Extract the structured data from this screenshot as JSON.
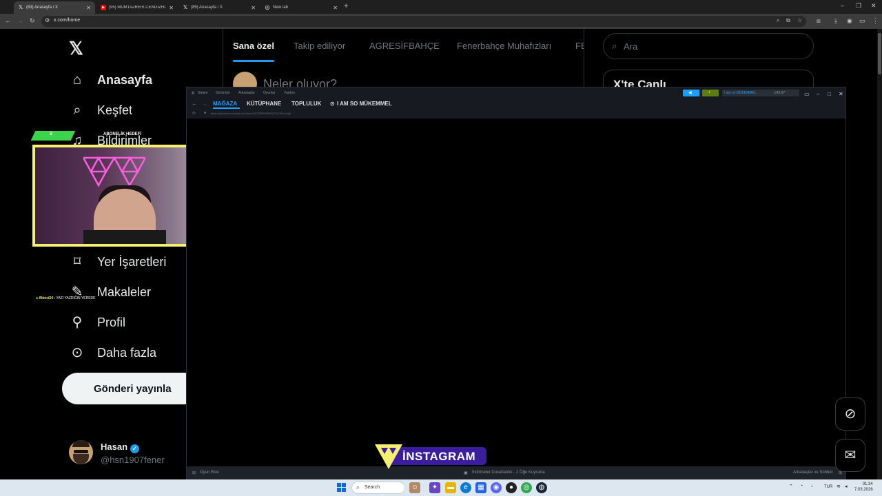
{
  "browser": {
    "tabs": [
      {
        "title": "(83) Anasayfa / X",
        "icon": "x-logo-icon",
        "active": true
      },
      {
        "title": "(95) MÜMTAZREİS CENGİZHAN",
        "icon": "youtube-icon",
        "active": false
      },
      {
        "title": "(85) Anasayfa / X",
        "icon": "x-logo-icon",
        "active": false
      },
      {
        "title": "New tab",
        "icon": "globe-icon",
        "active": false
      }
    ],
    "new_tab_symbol": "+",
    "url": "x.com/home"
  },
  "x": {
    "logo": "𝕏",
    "nav": [
      {
        "label": "Anasayfa",
        "icon": "home-icon",
        "glyph": "⌂",
        "bold": true
      },
      {
        "label": "Keşfet",
        "icon": "search-icon",
        "glyph": "⌕"
      },
      {
        "label": "Bildirimler",
        "icon": "bell-icon",
        "glyph": "♫"
      },
      {
        "label": "Yer İşaretleri",
        "icon": "bookmark-icon",
        "glyph": "⌑"
      },
      {
        "label": "Makaleler",
        "icon": "article-icon",
        "glyph": "✎"
      },
      {
        "label": "Profil",
        "icon": "profile-icon",
        "glyph": "⚲"
      },
      {
        "label": "Daha fazla",
        "icon": "more-icon",
        "glyph": "⊙"
      }
    ],
    "post_button": "Gönderi yayınla",
    "user": {
      "name": "Hasan",
      "handle": "@hsn1907fener",
      "verified_glyph": "✓"
    },
    "center_tabs": [
      "Sana özel",
      "Takip ediliyor",
      "AGRESİFBAHÇE",
      "Fenerbahçe Muhafızları",
      "FE"
    ],
    "compose_placeholder": "Neler oluyor?",
    "search_placeholder": "Ara",
    "live_title": "X'te Canlı",
    "accent": "#1d9bf0"
  },
  "overlay": {
    "goal_number": "2",
    "goal_label": "ABONELİK HEDEFİ",
    "goal_target": "10",
    "chat_user": "Akinci24 :",
    "chat_text": "YAZI YAZDIĞIN YEREDE",
    "instagram_label": "İNSTAGRAM"
  },
  "steam": {
    "menu": [
      "Steam",
      "Görünüm",
      "Arkadaşlar",
      "Oyunlar",
      "Yardım"
    ],
    "nav": [
      "MAĞAZA",
      "KÜTÜPHANE",
      "TOPLULUK",
      "I AM SO MÜKEMMEL"
    ],
    "url": "https://steamcommunity.com/trade/7573055959504734 76/receipt",
    "account": "I am so MÜKEMMEL",
    "wallet": "£49.87",
    "status_left": "Oyun Ekle",
    "status_center": "İndirmeler Duraklatıldı - 2 Öğe Kuyrukta",
    "status_right": "Arkadaşlar ve Sohbet"
  },
  "taskbar": {
    "search_placeholder": "Search",
    "lang": "TUR",
    "time": "01:34",
    "date": "7.03.2026"
  }
}
